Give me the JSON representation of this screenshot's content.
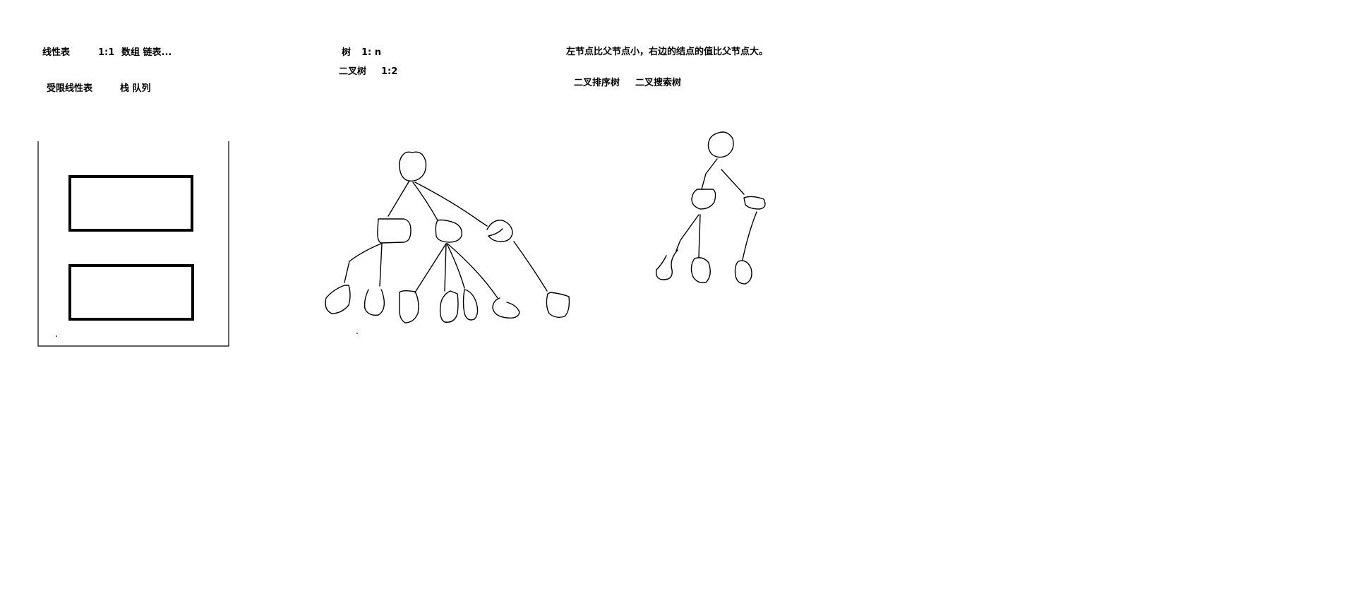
{
  "section_linear": {
    "title": "线性表",
    "relation": "1:1",
    "examples": "数组  链表...",
    "restricted_title": "受限线性表",
    "restricted_examples": "栈  队列"
  },
  "section_tree": {
    "title": "树",
    "relation": "1: n",
    "binary_title": "二叉树",
    "binary_relation": "1:2"
  },
  "section_bst": {
    "rule": "左节点比父节点小，右边的结点的值比父节点大。",
    "name_1": "二叉排序树",
    "name_2": "二叉搜索树"
  }
}
